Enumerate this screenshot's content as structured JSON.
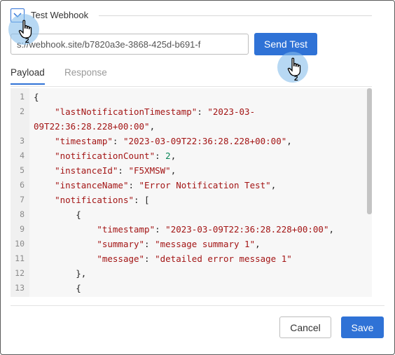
{
  "section": {
    "title": "Test Webhook",
    "collapse_icon": "chevron-down-icon"
  },
  "webhook": {
    "url": "s://webhook.site/b7820a3e-3868-425d-b691-f",
    "send_label": "Send Test"
  },
  "tabs": [
    {
      "label": "Payload",
      "active": true
    },
    {
      "label": "Response",
      "active": false
    }
  ],
  "payload_lines": [
    {
      "n": "1",
      "text": "{"
    },
    {
      "n": "2",
      "text": "    \"lastNotificationTimestamp\": \"2023-03-"
    },
    {
      "n": "",
      "text": "09T22:36:28.228+00:00\","
    },
    {
      "n": "3",
      "text": "    \"timestamp\": \"2023-03-09T22:36:28.228+00:00\","
    },
    {
      "n": "4",
      "text": "    \"notificationCount\": 2,"
    },
    {
      "n": "5",
      "text": "    \"instanceId\": \"F5XMSW\","
    },
    {
      "n": "6",
      "text": "    \"instanceName\": \"Error Notification Test\","
    },
    {
      "n": "7",
      "text": "    \"notifications\": ["
    },
    {
      "n": "8",
      "text": "        {"
    },
    {
      "n": "9",
      "text": "            \"timestamp\": \"2023-03-09T22:36:28.228+00:00\","
    },
    {
      "n": "10",
      "text": "            \"summary\": \"message summary 1\","
    },
    {
      "n": "11",
      "text": "            \"message\": \"detailed error message 1\""
    },
    {
      "n": "12",
      "text": "        },"
    },
    {
      "n": "13",
      "text": "        {"
    }
  ],
  "footer": {
    "cancel_label": "Cancel",
    "save_label": "Save"
  },
  "click_markers": [
    {
      "target": "collapse-toggle",
      "count": "2",
      "icon": "pointer-hand-icon"
    },
    {
      "target": "send-test-button",
      "count": "2",
      "icon": "pointer-hand-icon"
    }
  ],
  "colors": {
    "accent": "#2f72d6",
    "string": "#a31515",
    "number": "#098658",
    "halo": "#87beeb"
  }
}
